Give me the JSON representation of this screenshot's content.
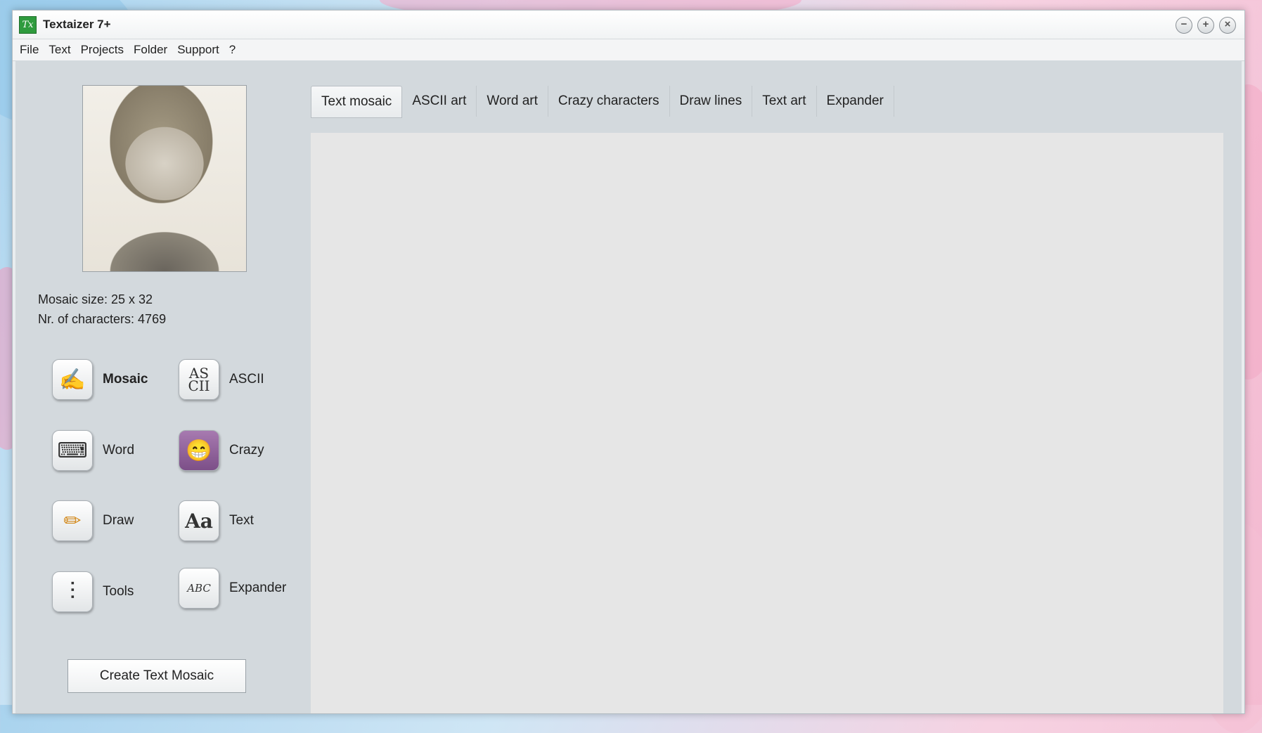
{
  "window": {
    "title": "Textaizer 7+",
    "app_icon_text": "Tx",
    "controls": {
      "minimize": "−",
      "maximize": "+",
      "close": "×"
    }
  },
  "menu": [
    "File",
    "Text",
    "Projects",
    "Folder",
    "Support",
    "?"
  ],
  "info": {
    "mosaic_size": "Mosaic size: 25 x 32",
    "characters": "Nr. of characters: 4769"
  },
  "tools": [
    {
      "label": "Mosaic",
      "icon": "mosaic-icon",
      "glyph": "✍",
      "active": true
    },
    {
      "label": "ASCII",
      "icon": "ascii-icon",
      "glyph": "AS\nCII"
    },
    {
      "label": "Word",
      "icon": "typewriter-icon",
      "glyph": "⌨"
    },
    {
      "label": "Crazy",
      "icon": "grin-face-icon",
      "glyph": "😁"
    },
    {
      "label": "Draw",
      "icon": "pencil-icon",
      "glyph": "✏"
    },
    {
      "label": "Text",
      "icon": "font-aa-icon",
      "glyph": "Aa"
    },
    {
      "label": "Tools",
      "icon": "sliders-icon",
      "glyph": "⫶"
    },
    {
      "label": "Expander",
      "icon": "brush-abc-icon",
      "glyph": "ABC"
    }
  ],
  "create_button": "Create Text Mosaic",
  "tabs": [
    "Text mosaic",
    "ASCII art",
    "Word art",
    "Crazy characters",
    "Draw lines",
    "Text art",
    "Expander"
  ],
  "active_tab": "Text mosaic"
}
